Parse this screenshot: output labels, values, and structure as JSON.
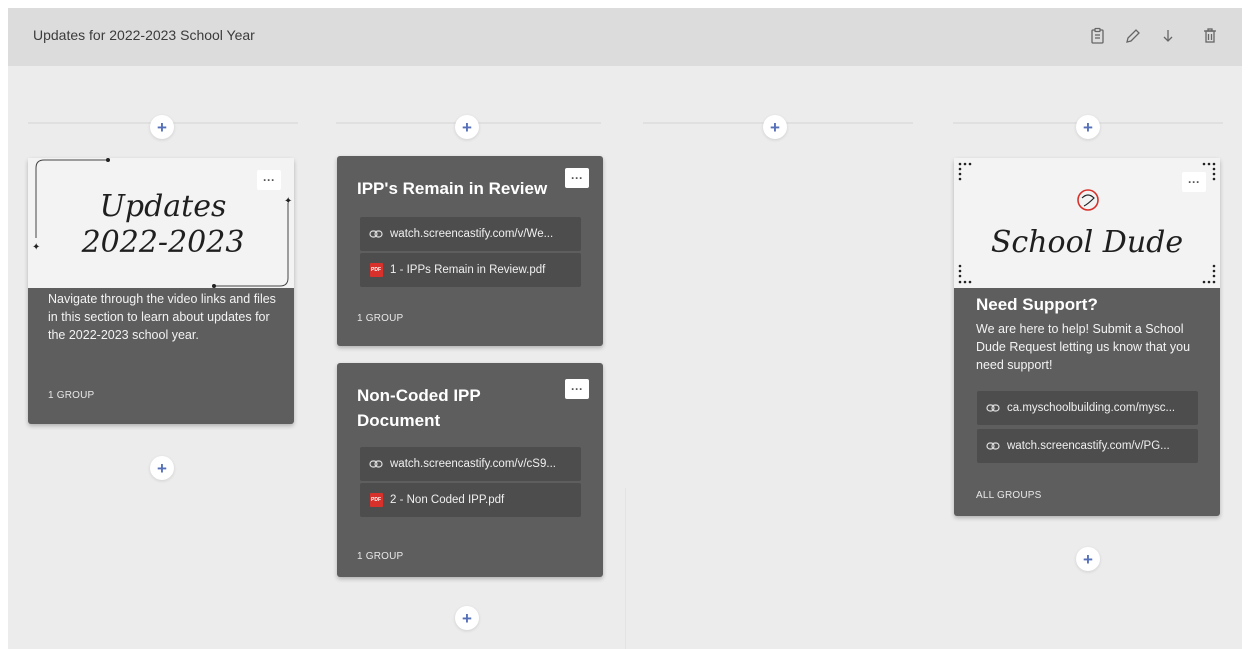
{
  "header": {
    "title": "Updates for 2022-2023 School Year",
    "icons": [
      "clipboard-icon",
      "pencil-icon",
      "download-arrow-icon",
      "trash-icon"
    ]
  },
  "add_label": "+",
  "more_label": "···",
  "colors": {
    "card_bg": "#5e5e5e",
    "attachment_bg": "#4d4d4d",
    "plus_accent": "#5570b8",
    "pdf_red": "#d8312b"
  },
  "columns": [
    {
      "cards": [
        {
          "image_text": [
            "Updates",
            "2022-2023"
          ],
          "description": "Navigate through the video links and files in this section to learn about updates for the 2022-2023 school year.",
          "group": "1 GROUP"
        }
      ]
    },
    {
      "cards": [
        {
          "title": "IPP's Remain in Review",
          "attachments": [
            {
              "type": "link",
              "text": "watch.screencastify.com/v/We..."
            },
            {
              "type": "pdf",
              "text": "1 - IPPs Remain in Review.pdf"
            }
          ],
          "group": "1 GROUP"
        },
        {
          "title": "Non-Coded IPP Document",
          "attachments": [
            {
              "type": "link",
              "text": "watch.screencastify.com/v/cS9..."
            },
            {
              "type": "pdf",
              "text": "2 - Non Coded IPP.pdf"
            }
          ],
          "group": "1 GROUP"
        }
      ]
    },
    {
      "cards": []
    },
    {
      "cards": [
        {
          "image_text": "School Dude",
          "title": "Need Support?",
          "description": "We are here to help! Submit a School Dude Request letting us know that you need support!",
          "attachments": [
            {
              "type": "link",
              "text": "ca.myschoolbuilding.com/mysc..."
            },
            {
              "type": "link",
              "text": "watch.screencastify.com/v/PG..."
            }
          ],
          "group": "ALL GROUPS"
        }
      ]
    }
  ]
}
